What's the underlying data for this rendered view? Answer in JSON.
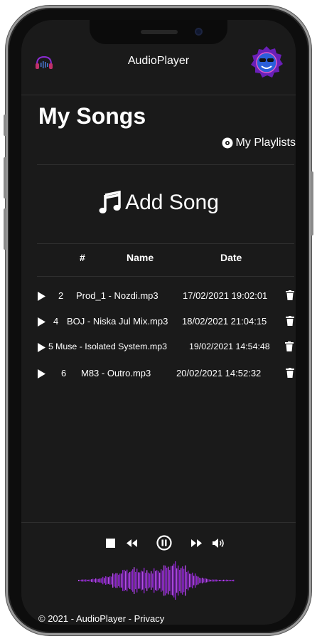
{
  "header": {
    "app_title": "AudioPlayer"
  },
  "page": {
    "title": "My Songs",
    "playlists_link": "My Playlists",
    "add_song_label": "Add Song"
  },
  "table": {
    "columns": [
      "#",
      "Name",
      "Date"
    ],
    "rows": [
      {
        "id": "2",
        "name": "Prod_1 - Nozdi.mp3",
        "date": "17/02/2021 19:02:01"
      },
      {
        "id": "4",
        "name": "BOJ - Niska Jul Mix.mp3",
        "date": "18/02/2021 21:04:15"
      },
      {
        "id": "5",
        "name": "Muse - Isolated System.mp3",
        "date": "19/02/2021 14:54:48"
      },
      {
        "id": "6",
        "name": "M83 - Outro.mp3",
        "date": "20/02/2021 14:52:32"
      }
    ]
  },
  "player": {
    "controls": [
      "stop-icon",
      "rewind-icon",
      "pause-icon",
      "fast-forward-icon",
      "volume-icon"
    ]
  },
  "footer": {
    "copyright": "© 2021 - AudioPlayer - ",
    "privacy": "Privacy"
  },
  "colors": {
    "background": "#1a1a1a",
    "accent_purple": "#9b30d9",
    "text": "#ffffff"
  }
}
